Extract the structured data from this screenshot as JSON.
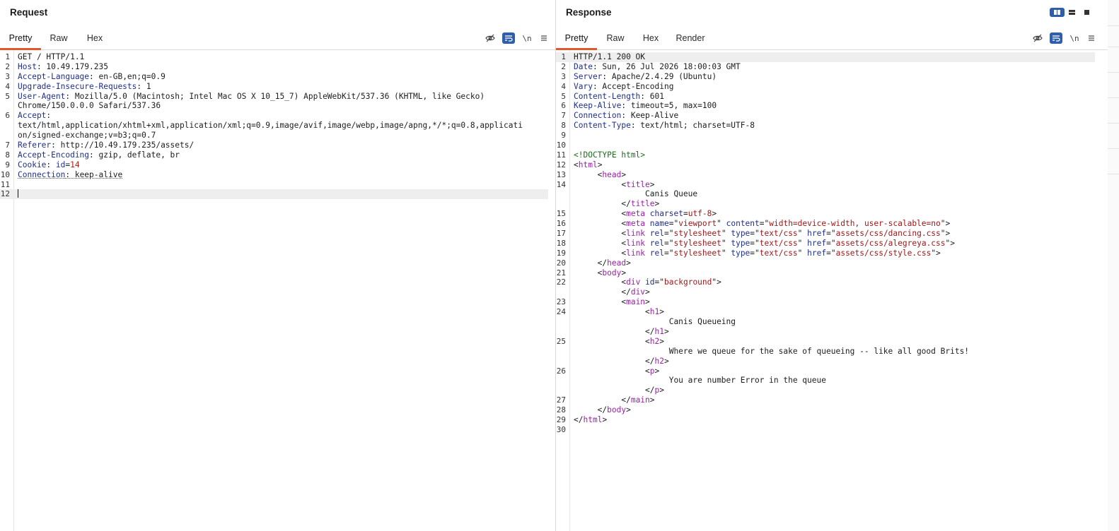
{
  "request": {
    "title": "Request",
    "tabs": [
      "Pretty",
      "Raw",
      "Hex"
    ],
    "newline_label": "\\n",
    "lines": [
      {
        "n": "1",
        "segs": [
          [
            "t",
            "GET / HTTP/1.1"
          ]
        ]
      },
      {
        "n": "2",
        "segs": [
          [
            "k",
            "Host"
          ],
          [
            "t",
            ": 10.49.179.235"
          ]
        ]
      },
      {
        "n": "3",
        "segs": [
          [
            "k",
            "Accept-Language"
          ],
          [
            "t",
            ": en-GB,en;q=0.9"
          ]
        ]
      },
      {
        "n": "4",
        "segs": [
          [
            "k",
            "Upgrade-Insecure-Requests"
          ],
          [
            "t",
            ": 1"
          ]
        ]
      },
      {
        "n": "5",
        "segs": [
          [
            "k",
            "User-Agent"
          ],
          [
            "t",
            ": Mozilla/5.0 (Macintosh; Intel Mac OS X 10_15_7) AppleWebKit/537.36 (KHTML, like Gecko)"
          ]
        ]
      },
      {
        "n": "",
        "segs": [
          [
            "t",
            "Chrome/150.0.0.0 Safari/537.36"
          ]
        ]
      },
      {
        "n": "6",
        "segs": [
          [
            "k",
            "Accept"
          ],
          [
            "t",
            ":"
          ]
        ]
      },
      {
        "n": "",
        "segs": [
          [
            "t",
            "text/html,application/xhtml+xml,application/xml;q=0.9,image/avif,image/webp,image/apng,*/*;q=0.8,applicati"
          ]
        ]
      },
      {
        "n": "",
        "segs": [
          [
            "t",
            "on/signed-exchange;v=b3;q=0.7"
          ]
        ]
      },
      {
        "n": "7",
        "segs": [
          [
            "k",
            "Referer"
          ],
          [
            "t",
            ": http://10.49.179.235/assets/"
          ]
        ]
      },
      {
        "n": "8",
        "segs": [
          [
            "k",
            "Accept-Encoding"
          ],
          [
            "t",
            ": gzip, deflate, br"
          ]
        ]
      },
      {
        "n": "9",
        "segs": [
          [
            "k",
            "Cookie"
          ],
          [
            "t",
            ": "
          ],
          [
            "k",
            "id"
          ],
          [
            "t",
            "="
          ],
          [
            "nm",
            "14"
          ]
        ]
      },
      {
        "n": "10",
        "segs": [
          [
            "kd",
            "Connection"
          ],
          [
            "td",
            ": keep-alive"
          ]
        ]
      },
      {
        "n": "11",
        "segs": []
      },
      {
        "n": "12",
        "segs": [],
        "cursor": true
      }
    ]
  },
  "response": {
    "title": "Response",
    "tabs": [
      "Pretty",
      "Raw",
      "Hex",
      "Render"
    ],
    "newline_label": "\\n",
    "lines": [
      {
        "n": "1",
        "segs": [
          [
            "t",
            "HTTP/1.1 200 OK"
          ]
        ],
        "hl": true
      },
      {
        "n": "2",
        "segs": [
          [
            "k",
            "Date"
          ],
          [
            "t",
            ": Sun, 26 Jul 2026 18:00:03 GMT"
          ]
        ]
      },
      {
        "n": "3",
        "segs": [
          [
            "k",
            "Server"
          ],
          [
            "t",
            ": Apache/2.4.29 (Ubuntu)"
          ]
        ]
      },
      {
        "n": "4",
        "segs": [
          [
            "k",
            "Vary"
          ],
          [
            "t",
            ": Accept-Encoding"
          ]
        ]
      },
      {
        "n": "5",
        "segs": [
          [
            "k",
            "Content-Length"
          ],
          [
            "t",
            ": 601"
          ]
        ]
      },
      {
        "n": "6",
        "segs": [
          [
            "k",
            "Keep-Alive"
          ],
          [
            "t",
            ": timeout=5, max=100"
          ]
        ]
      },
      {
        "n": "7",
        "segs": [
          [
            "k",
            "Connection"
          ],
          [
            "t",
            ": Keep-Alive"
          ]
        ]
      },
      {
        "n": "8",
        "segs": [
          [
            "k",
            "Content-Type"
          ],
          [
            "t",
            ": text/html; charset=UTF-8"
          ]
        ]
      },
      {
        "n": "9",
        "segs": []
      },
      {
        "n": "10",
        "segs": []
      },
      {
        "n": "11",
        "segs": [
          [
            "dt",
            "<!DOCTYPE html>"
          ]
        ]
      },
      {
        "n": "12",
        "segs": [
          [
            "t",
            "<"
          ],
          [
            "tg",
            "html"
          ],
          [
            "t",
            ">"
          ]
        ]
      },
      {
        "n": "13",
        "segs": [
          [
            "t",
            "     <"
          ],
          [
            "tg",
            "head"
          ],
          [
            "t",
            ">"
          ]
        ]
      },
      {
        "n": "14",
        "segs": [
          [
            "t",
            "          <"
          ],
          [
            "tg",
            "title"
          ],
          [
            "t",
            ">"
          ]
        ]
      },
      {
        "n": "",
        "segs": [
          [
            "t",
            "               Canis Queue"
          ]
        ]
      },
      {
        "n": "",
        "segs": [
          [
            "t",
            "          </"
          ],
          [
            "tg",
            "title"
          ],
          [
            "t",
            ">"
          ]
        ]
      },
      {
        "n": "15",
        "segs": [
          [
            "t",
            "          <"
          ],
          [
            "tg",
            "meta"
          ],
          [
            "t",
            " "
          ],
          [
            "at",
            "charset"
          ],
          [
            "t",
            "="
          ],
          [
            "sv",
            "utf-8"
          ],
          [
            "t",
            ">"
          ]
        ]
      },
      {
        "n": "16",
        "segs": [
          [
            "t",
            "          <"
          ],
          [
            "tg",
            "meta"
          ],
          [
            "t",
            " "
          ],
          [
            "at",
            "name"
          ],
          [
            "t",
            "=\""
          ],
          [
            "sv",
            "viewport"
          ],
          [
            "t",
            "\" "
          ],
          [
            "at",
            "content"
          ],
          [
            "t",
            "=\""
          ],
          [
            "sv",
            "width=device-width, user-scalable=no"
          ],
          [
            "t",
            "\">"
          ]
        ]
      },
      {
        "n": "17",
        "segs": [
          [
            "t",
            "          <"
          ],
          [
            "tg",
            "link"
          ],
          [
            "t",
            " "
          ],
          [
            "at",
            "rel"
          ],
          [
            "t",
            "=\""
          ],
          [
            "sv",
            "stylesheet"
          ],
          [
            "t",
            "\" "
          ],
          [
            "at",
            "type"
          ],
          [
            "t",
            "=\""
          ],
          [
            "sv",
            "text/css"
          ],
          [
            "t",
            "\" "
          ],
          [
            "at",
            "href"
          ],
          [
            "t",
            "=\""
          ],
          [
            "sv",
            "assets/css/dancing.css"
          ],
          [
            "t",
            "\">"
          ]
        ]
      },
      {
        "n": "18",
        "segs": [
          [
            "t",
            "          <"
          ],
          [
            "tg",
            "link"
          ],
          [
            "t",
            " "
          ],
          [
            "at",
            "rel"
          ],
          [
            "t",
            "=\""
          ],
          [
            "sv",
            "stylesheet"
          ],
          [
            "t",
            "\" "
          ],
          [
            "at",
            "type"
          ],
          [
            "t",
            "=\""
          ],
          [
            "sv",
            "text/css"
          ],
          [
            "t",
            "\" "
          ],
          [
            "at",
            "href"
          ],
          [
            "t",
            "=\""
          ],
          [
            "sv",
            "assets/css/alegreya.css"
          ],
          [
            "t",
            "\">"
          ]
        ]
      },
      {
        "n": "19",
        "segs": [
          [
            "t",
            "          <"
          ],
          [
            "tg",
            "link"
          ],
          [
            "t",
            " "
          ],
          [
            "at",
            "rel"
          ],
          [
            "t",
            "=\""
          ],
          [
            "sv",
            "stylesheet"
          ],
          [
            "t",
            "\" "
          ],
          [
            "at",
            "type"
          ],
          [
            "t",
            "=\""
          ],
          [
            "sv",
            "text/css"
          ],
          [
            "t",
            "\" "
          ],
          [
            "at",
            "href"
          ],
          [
            "t",
            "=\""
          ],
          [
            "sv",
            "assets/css/style.css"
          ],
          [
            "t",
            "\">"
          ]
        ]
      },
      {
        "n": "20",
        "segs": [
          [
            "t",
            "     </"
          ],
          [
            "tg",
            "head"
          ],
          [
            "t",
            ">"
          ]
        ]
      },
      {
        "n": "21",
        "segs": [
          [
            "t",
            "     <"
          ],
          [
            "tg",
            "body"
          ],
          [
            "t",
            ">"
          ]
        ]
      },
      {
        "n": "22",
        "segs": [
          [
            "t",
            "          <"
          ],
          [
            "tg",
            "div"
          ],
          [
            "t",
            " "
          ],
          [
            "at",
            "id"
          ],
          [
            "t",
            "=\""
          ],
          [
            "sv",
            "background"
          ],
          [
            "t",
            "\">"
          ]
        ]
      },
      {
        "n": "",
        "segs": [
          [
            "t",
            "          </"
          ],
          [
            "tg",
            "div"
          ],
          [
            "t",
            ">"
          ]
        ]
      },
      {
        "n": "23",
        "segs": [
          [
            "t",
            "          <"
          ],
          [
            "tg",
            "main"
          ],
          [
            "t",
            ">"
          ]
        ]
      },
      {
        "n": "24",
        "segs": [
          [
            "t",
            "               <"
          ],
          [
            "tg",
            "h1"
          ],
          [
            "t",
            ">"
          ]
        ]
      },
      {
        "n": "",
        "segs": [
          [
            "t",
            "                    Canis Queueing"
          ]
        ]
      },
      {
        "n": "",
        "segs": [
          [
            "t",
            "               </"
          ],
          [
            "tg",
            "h1"
          ],
          [
            "t",
            ">"
          ]
        ]
      },
      {
        "n": "25",
        "segs": [
          [
            "t",
            "               <"
          ],
          [
            "tg",
            "h2"
          ],
          [
            "t",
            ">"
          ]
        ]
      },
      {
        "n": "",
        "segs": [
          [
            "t",
            "                    Where we queue for the sake of queueing -- like all good Brits!"
          ]
        ]
      },
      {
        "n": "",
        "segs": [
          [
            "t",
            "               </"
          ],
          [
            "tg",
            "h2"
          ],
          [
            "t",
            ">"
          ]
        ]
      },
      {
        "n": "26",
        "segs": [
          [
            "t",
            "               <"
          ],
          [
            "tg",
            "p"
          ],
          [
            "t",
            ">"
          ]
        ]
      },
      {
        "n": "",
        "segs": [
          [
            "t",
            "                    You are number Error in the queue"
          ]
        ]
      },
      {
        "n": "",
        "segs": [
          [
            "t",
            "               </"
          ],
          [
            "tg",
            "p"
          ],
          [
            "t",
            ">"
          ]
        ]
      },
      {
        "n": "27",
        "segs": [
          [
            "t",
            "          </"
          ],
          [
            "tg",
            "main"
          ],
          [
            "t",
            ">"
          ]
        ]
      },
      {
        "n": "28",
        "segs": [
          [
            "t",
            "     </"
          ],
          [
            "tg",
            "body"
          ],
          [
            "t",
            ">"
          ]
        ]
      },
      {
        "n": "29",
        "segs": [
          [
            "t",
            "</"
          ],
          [
            "tg",
            "html"
          ],
          [
            "t",
            ">"
          ]
        ]
      },
      {
        "n": "30",
        "segs": []
      }
    ]
  },
  "icons": {
    "hide": "eye-off-icon",
    "wrap": "word-wrap-icon",
    "menu": "hamburger-menu-icon",
    "layout": [
      "layout-side-by-side-icon",
      "layout-stacked-icon",
      "layout-single-icon"
    ]
  },
  "colors": {
    "accent_tab": "#e0582b",
    "active_button": "#2f5fa8",
    "header_name": "#1f2f8c",
    "html_tag": "#9a20a8",
    "attr_value": "#a01818",
    "doctype": "#1e6b1e"
  }
}
